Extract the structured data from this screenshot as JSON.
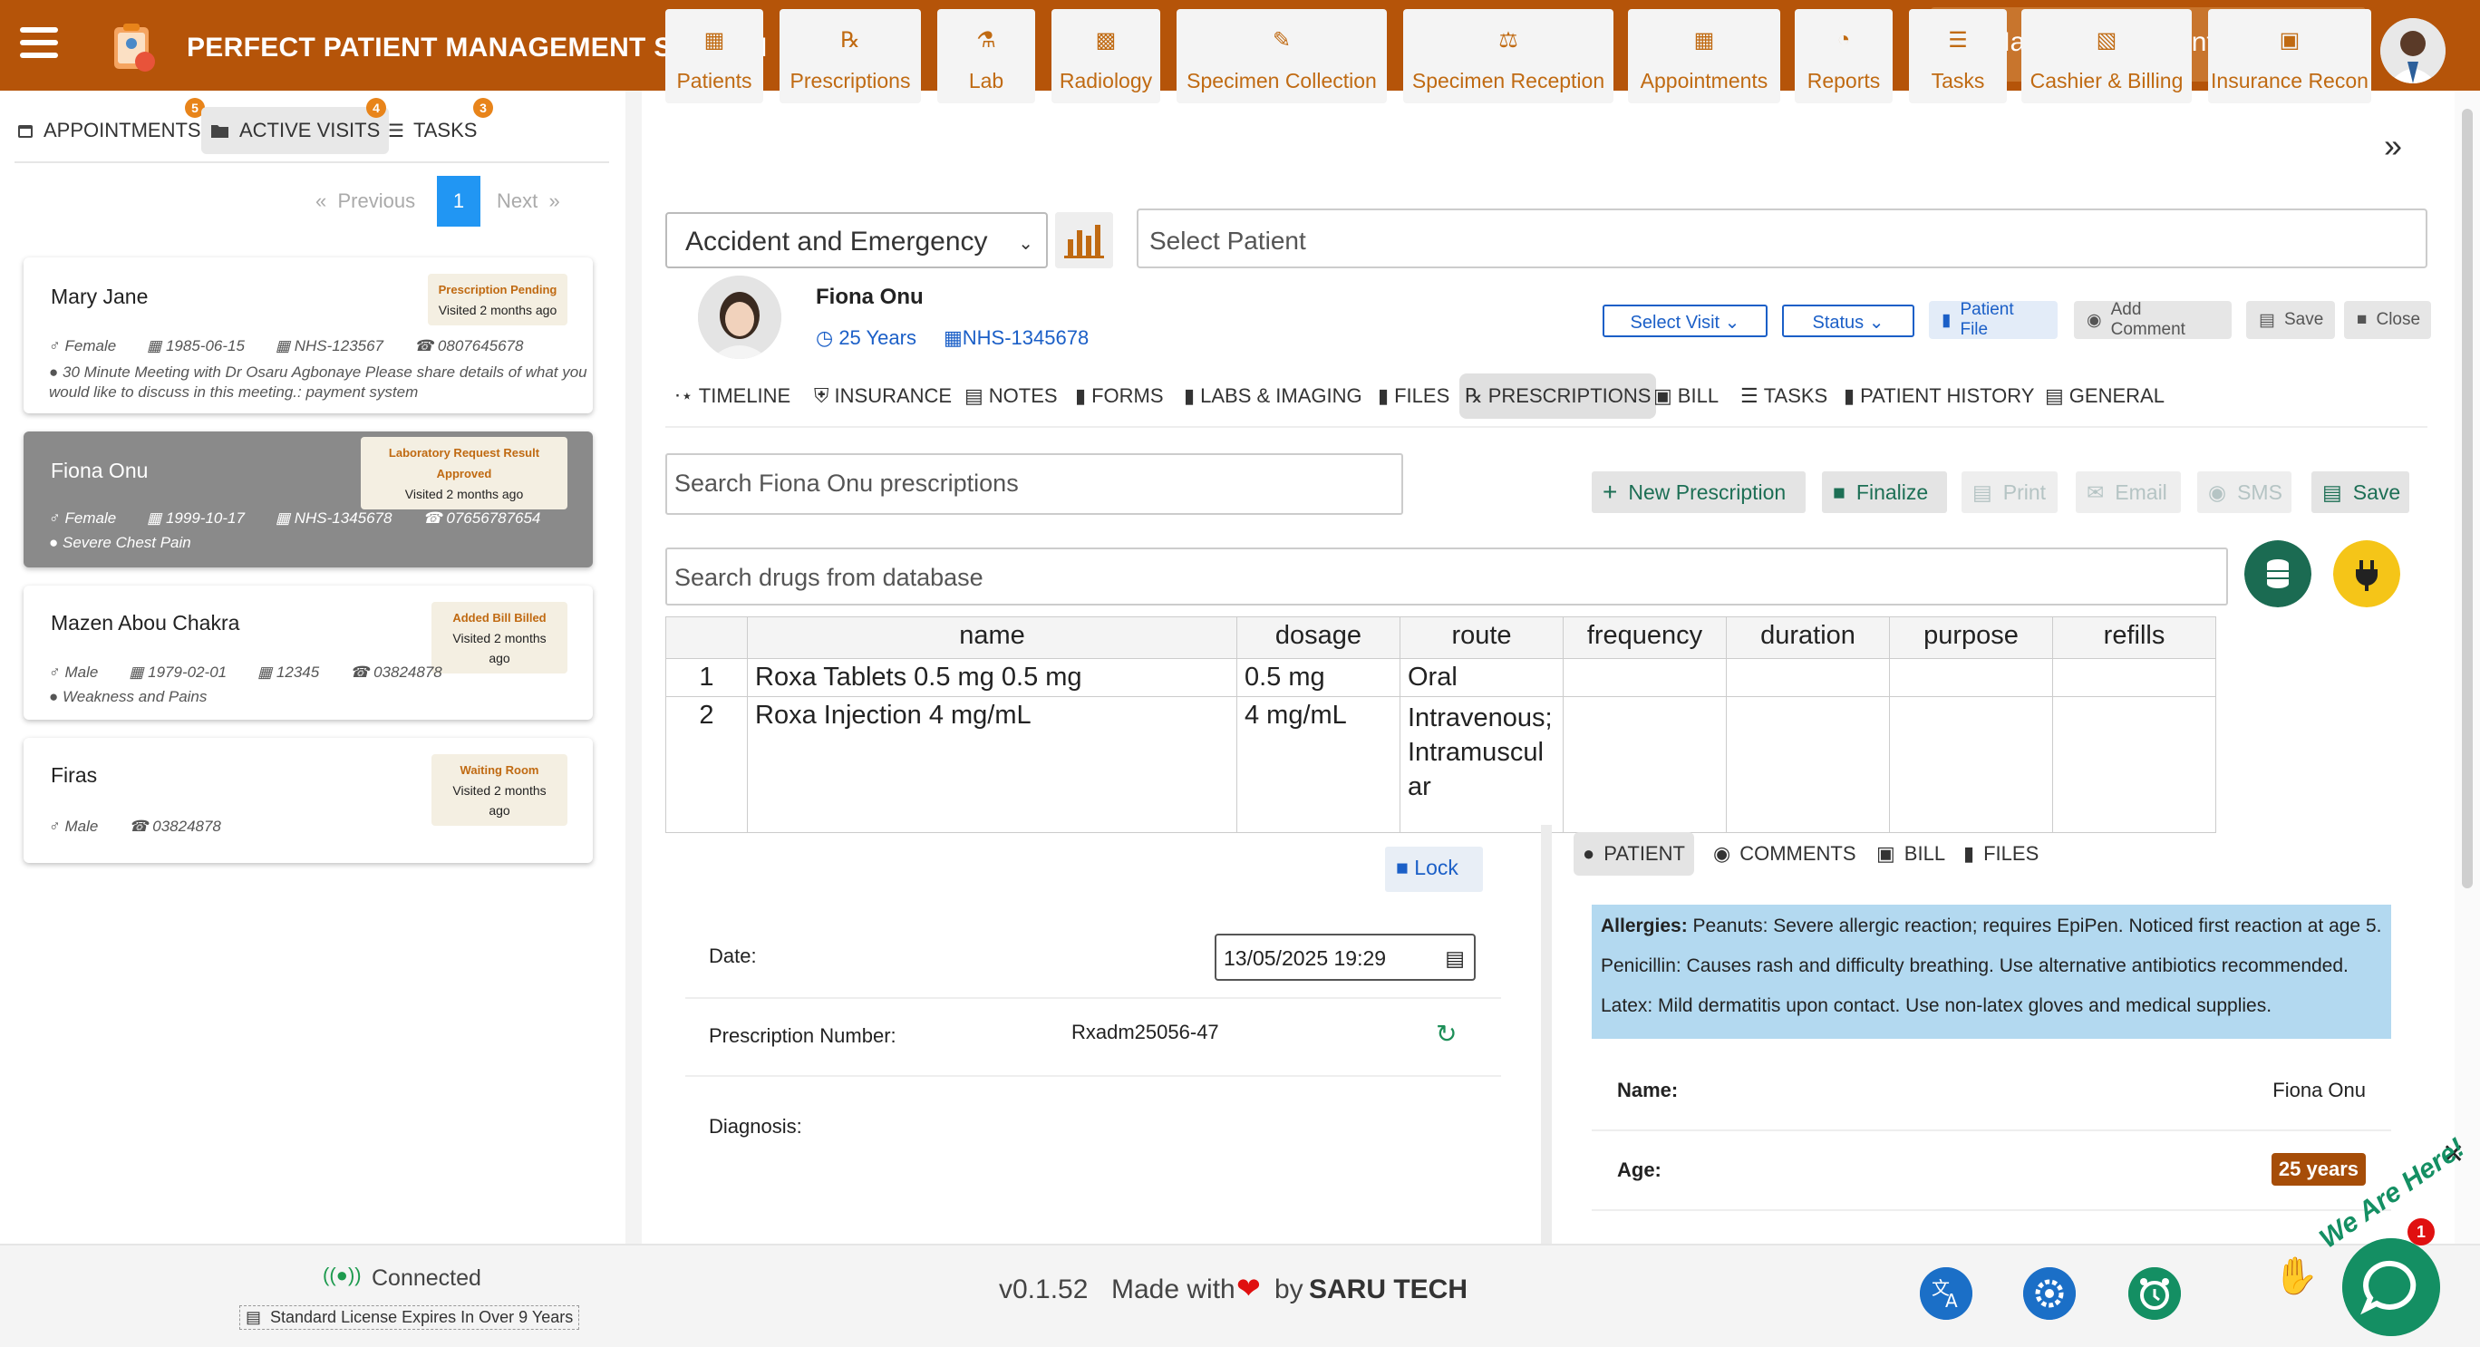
{
  "app": {
    "title": "PERFECT PATIENT MANAGEMENT SYSTEM",
    "facility": "St Mary Medical Center"
  },
  "left": {
    "tabs": [
      {
        "label": "APPOINTMENTS",
        "count": "5"
      },
      {
        "label": "ACTIVE VISITS",
        "count": "4"
      },
      {
        "label": "TASKS",
        "count": "3"
      }
    ],
    "pager": {
      "prev": "Previous",
      "page": "1",
      "next": "Next"
    },
    "patients": [
      {
        "name": "Mary Jane",
        "status": "Prescription Pending",
        "visited": "Visited 2 months ago",
        "gender": "Female",
        "dob": "1985-06-15",
        "nhs": "NHS-123567",
        "phone": "0807645678",
        "note": "30 Minute Meeting with Dr Osaru Agbonaye Please share details of what you would like to discuss in this meeting.: payment system"
      },
      {
        "name": "Fiona Onu",
        "status": "Laboratory Request Result Approved",
        "visited": "Visited 2 months ago",
        "gender": "Female",
        "dob": "1999-10-17",
        "nhs": "NHS-1345678",
        "phone": "07656787654",
        "note": "Severe Chest Pain"
      },
      {
        "name": "Mazen Abou Chakra",
        "status": "Added Bill Billed",
        "visited": "Visited 2 months ago",
        "gender": "Male",
        "dob": "1979-02-01",
        "nhs": "12345",
        "phone": "03824878",
        "note": "Weakness and Pains"
      },
      {
        "name": "Firas",
        "status": "Waiting Room",
        "visited": "Visited 2 months ago",
        "gender": "Male",
        "phone": "03824878"
      }
    ]
  },
  "modules": [
    {
      "label": "Patients",
      "icon": "patients-icon"
    },
    {
      "label": "Prescriptions",
      "icon": "rx-icon"
    },
    {
      "label": "Lab",
      "icon": "flask-icon"
    },
    {
      "label": "Radiology",
      "icon": "radiology-icon"
    },
    {
      "label": "Specimen Collection",
      "icon": "syringe-icon"
    },
    {
      "label": "Specimen Reception",
      "icon": "reception-icon"
    },
    {
      "label": "Appointments",
      "icon": "calendar-icon"
    },
    {
      "label": "Reports",
      "icon": "pie-chart-icon"
    },
    {
      "label": "Tasks",
      "icon": "tasks-icon"
    },
    {
      "label": "Cashier & Billing",
      "icon": "cashier-icon"
    },
    {
      "label": "Insurance Recon",
      "icon": "insurance-icon"
    }
  ],
  "department": "Accident and Emergency",
  "patient_select_placeholder": "Select  Patient",
  "patient": {
    "name": "Fiona Onu",
    "age": "25 Years",
    "nhs": "NHS-1345678"
  },
  "header_actions": {
    "select_visit": "Select Visit",
    "status": "Status",
    "patient_file": "Patient File",
    "add_comment": "Add Comment",
    "save": "Save",
    "close": "Close"
  },
  "subtabs": [
    "TIMELINE",
    "INSURANCE",
    "NOTES",
    "FORMS",
    "LABS & IMAGING",
    "FILES",
    "PRESCRIPTIONS",
    "BILL",
    "TASKS",
    "PATIENT HISTORY",
    "GENERAL"
  ],
  "rx": {
    "search_placeholder": "Search Fiona Onu prescriptions",
    "drug_search_placeholder": "Search drugs from database",
    "actions": {
      "new": "New Prescription",
      "finalize": "Finalize",
      "print": "Print",
      "email": "Email",
      "sms": "SMS",
      "save": "Save"
    },
    "columns": [
      "name",
      "dosage",
      "route",
      "frequency",
      "duration",
      "purpose",
      "refills"
    ],
    "rows": [
      {
        "no": "1",
        "name": "Roxa Tablets 0.5 mg 0.5 mg",
        "dosage": "0.5 mg",
        "route": "Oral"
      },
      {
        "no": "2",
        "name": "Roxa Injection 4 mg/mL",
        "dosage": "4 mg/mL",
        "route": "Intravenous; Intramuscul ar"
      }
    ]
  },
  "form": {
    "lock": "Lock",
    "date_label": "Date:",
    "date_value": "13/05/2025 19:29",
    "rxnum_label": "Prescription Number:",
    "rxnum_value": "Rxadm25056-47",
    "diagnosis_label": "Diagnosis:"
  },
  "right": {
    "tabs": [
      "PATIENT",
      "COMMENTS",
      "BILL",
      "FILES"
    ],
    "allergies_label": "Allergies:",
    "allergies_text": "Peanuts: Severe allergic reaction; requires EpiPen. Noticed first reaction at age 5. Penicillin: Causes rash and difficulty breathing. Use alternative antibiotics recommended. Latex: Mild dermatitis upon contact. Use non-latex gloves and medical supplies.",
    "name_label": "Name:",
    "name_value": "Fiona Onu",
    "age_label": "Age:",
    "age_value": "25 years"
  },
  "footer": {
    "connected": "Connected",
    "license": "Standard License Expires In Over 9 Years",
    "version": "v0.1.52",
    "made_with": "Made with",
    "by": "by",
    "company": "SARU TECH",
    "chat_badge": "1",
    "chat_label": "We Are Here!"
  },
  "colors": {
    "brand": "#b55409",
    "accent": "#c06a12",
    "link": "#1b5fc7",
    "allergy_bg": "#b3d9f0"
  }
}
